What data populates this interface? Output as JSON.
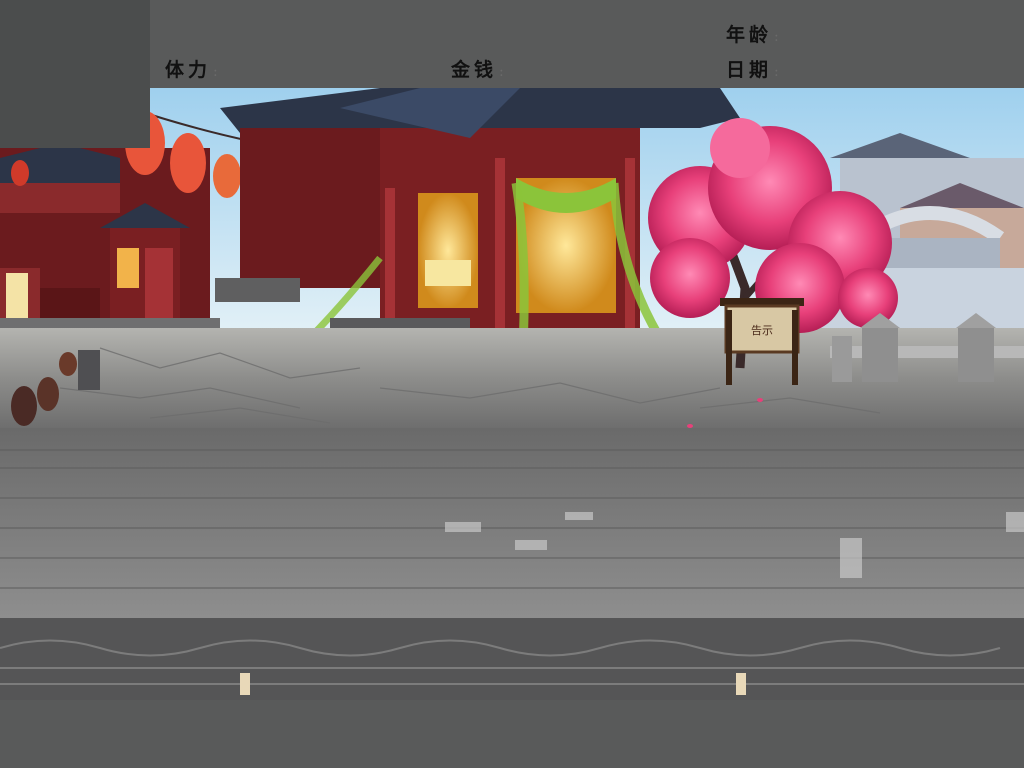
{
  "hud": {
    "age_label": "年龄",
    "stamina_label": "体力",
    "money_label": "金钱",
    "date_label": "日期",
    "separator": ":"
  },
  "scene": {
    "name": "street-background",
    "sign_text": "告示"
  },
  "colors": {
    "hud_bg": "#595a5a",
    "portrait_bg": "#4b4d4d",
    "blossom": "#e8407a",
    "lantern": "#e8553a",
    "roof": "#2c3548",
    "wall": "#7a1f22",
    "ground": "#8a8a8a"
  }
}
